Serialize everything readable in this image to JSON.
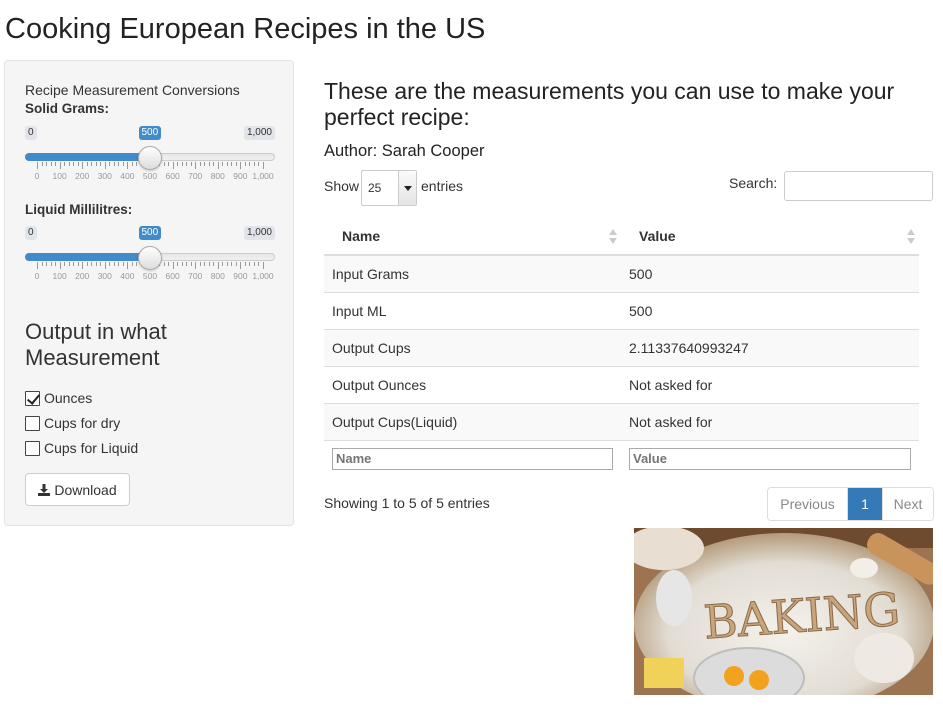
{
  "app": {
    "title": "Cooking European Recipes in the US"
  },
  "sidebar": {
    "heading": "Recipe Measurement Conversions",
    "solid": {
      "label": "Solid Grams:",
      "min": "0",
      "max": "1,000",
      "value": "500",
      "fraction": 0.5,
      "tick_labels": [
        "0",
        "100",
        "200",
        "300",
        "400",
        "500",
        "600",
        "700",
        "800",
        "900",
        "1,000"
      ]
    },
    "liquid": {
      "label": "Liquid Millilitres:",
      "min": "0",
      "max": "1,000",
      "value": "500",
      "fraction": 0.5,
      "tick_labels": [
        "0",
        "100",
        "200",
        "300",
        "400",
        "500",
        "600",
        "700",
        "800",
        "900",
        "1,000"
      ]
    },
    "output_heading": "Output in what Measurement",
    "checkboxes": [
      {
        "label": "Ounces",
        "checked": true
      },
      {
        "label": "Cups for dry",
        "checked": false
      },
      {
        "label": "Cups for Liquid",
        "checked": false
      }
    ],
    "download_label": "Download"
  },
  "main": {
    "heading": "These are the measurements you can use to make your perfect recipe:",
    "author": "Author: Sarah Cooper",
    "show_label": "Show",
    "page_length": "25",
    "entries_label": "entries",
    "search_label": "Search:",
    "search_value": "",
    "table": {
      "columns": [
        "Name",
        "Value"
      ],
      "rows": [
        [
          "Input Grams",
          "500"
        ],
        [
          "Input ML",
          "500"
        ],
        [
          "Output Cups",
          "2.11337640993247"
        ],
        [
          "Output Ounces",
          "Not asked for"
        ],
        [
          "Output Cups(Liquid)",
          "Not asked for"
        ]
      ],
      "filter_placeholders": [
        "Name",
        "Value"
      ]
    },
    "info": "Showing 1 to 5 of 5 entries",
    "pagination": {
      "previous": "Previous",
      "current": "1",
      "next": "Next"
    },
    "image_text": "BAKING"
  },
  "colors": {
    "accent": "#428bca",
    "page_active": "#337ab7",
    "sidebar_bg": "#f5f5f5"
  }
}
